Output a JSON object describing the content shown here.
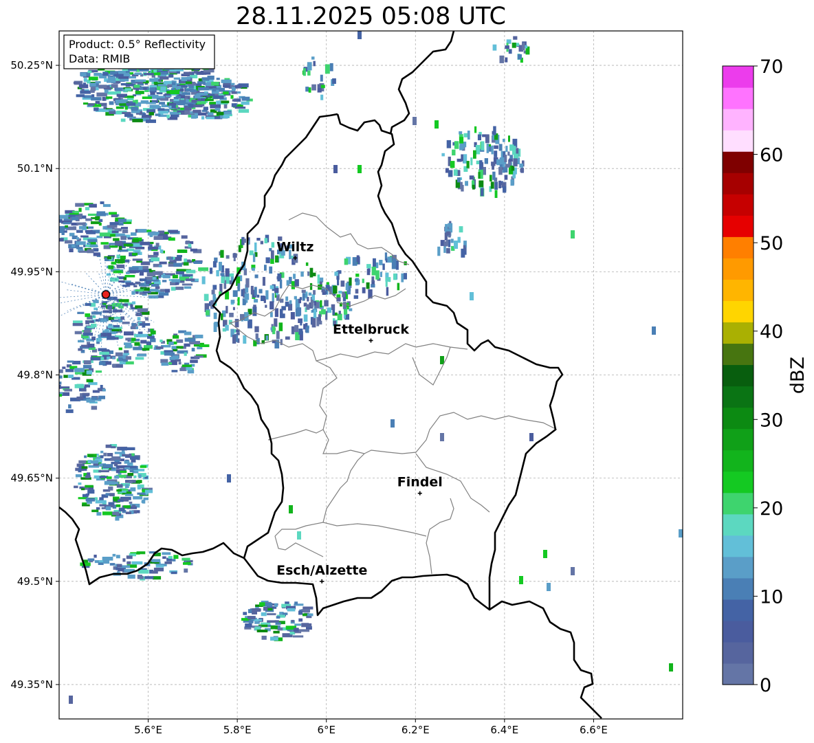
{
  "title": "28.11.2025 05:08 UTC",
  "info": {
    "product": "Product: 0.5° Reflectivity",
    "source": "Data: RMIB"
  },
  "map": {
    "lon_range": [
      5.4,
      6.8
    ],
    "lat_range": [
      49.3,
      50.3
    ],
    "grid": true,
    "x_ticks": [
      {
        "value": 5.6,
        "label": "5.6°E"
      },
      {
        "value": 5.8,
        "label": "5.8°E"
      },
      {
        "value": 6.0,
        "label": "6°E"
      },
      {
        "value": 6.2,
        "label": "6.2°E"
      },
      {
        "value": 6.4,
        "label": "6.4°E"
      },
      {
        "value": 6.6,
        "label": "6.6°E"
      }
    ],
    "y_ticks": [
      {
        "value": 50.25,
        "label": "50.25°N"
      },
      {
        "value": 50.1,
        "label": "50.1°N"
      },
      {
        "value": 49.95,
        "label": "49.95°N"
      },
      {
        "value": 49.8,
        "label": "49.8°N"
      },
      {
        "value": 49.65,
        "label": "49.65°N"
      },
      {
        "value": 49.5,
        "label": "49.5°N"
      },
      {
        "value": 49.35,
        "label": "49.35°N"
      }
    ],
    "cities": [
      {
        "name": "Wiltz",
        "lon": 5.93,
        "lat": 49.97
      },
      {
        "name": "Ettelbruck",
        "lon": 6.1,
        "lat": 49.85
      },
      {
        "name": "Findel",
        "lon": 6.21,
        "lat": 49.628
      },
      {
        "name": "Esch/Alzette",
        "lon": 5.99,
        "lat": 49.5
      }
    ],
    "radar_site": {
      "lon": 5.505,
      "lat": 49.917,
      "color": "#e8231e"
    }
  },
  "colorbar": {
    "label": "dBZ",
    "min": 0,
    "max": 70,
    "ticks": [
      {
        "value": 0,
        "label": "0"
      },
      {
        "value": 10,
        "label": "10"
      },
      {
        "value": 20,
        "label": "20"
      },
      {
        "value": 30,
        "label": "30"
      },
      {
        "value": 40,
        "label": "40"
      },
      {
        "value": 50,
        "label": "50"
      },
      {
        "value": 60,
        "label": "60"
      },
      {
        "value": 70,
        "label": "70"
      }
    ],
    "colors": [
      "#6475a6",
      "#56659e",
      "#4a5c9e",
      "#4463a5",
      "#4a7fb5",
      "#5a9ec8",
      "#62bfd8",
      "#5cd8c0",
      "#3ed46e",
      "#14c922",
      "#12b41c",
      "#10a018",
      "#0c8a12",
      "#0a7414",
      "#085e0e",
      "#477510",
      "#aab002",
      "#ffd500",
      "#ffb500",
      "#ff9a00",
      "#ff7f00",
      "#e60000",
      "#c60000",
      "#a60000",
      "#7f0000",
      "#ffdeff",
      "#ffb3ff",
      "#ff73ff",
      "#ec3cec"
    ]
  }
}
